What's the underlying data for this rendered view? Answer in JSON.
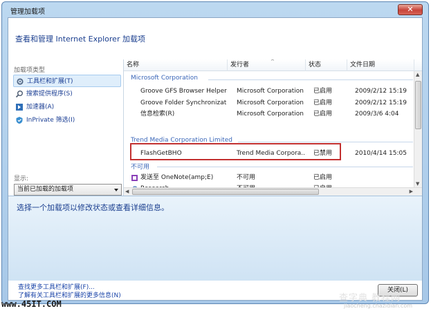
{
  "window": {
    "title": "管理加载项",
    "close_glyph": "✕"
  },
  "header": {
    "text": "查看和管理 Internet Explorer 加载项"
  },
  "sidebar": {
    "type_label": "加载项类型",
    "items": [
      {
        "label": "工具栏和扩展(T)",
        "icon": "gear-icon",
        "selected": true
      },
      {
        "label": "搜索提供程序(S)",
        "icon": "search-icon",
        "selected": false
      },
      {
        "label": "加速器(A)",
        "icon": "accelerator-icon",
        "selected": false
      },
      {
        "label": "InPrivate 筛选(I)",
        "icon": "inprivate-icon",
        "selected": false
      }
    ],
    "show_label": "显示:",
    "show_value": "当前已加载的加载项"
  },
  "list": {
    "columns": [
      "名称",
      "发行者",
      "状态",
      "文件日期"
    ],
    "groups": [
      {
        "name": "Microsoft Corporation",
        "rows": [
          {
            "name": "Groove GFS Browser Helper",
            "publisher": "Microsoft Corporation",
            "status": "已启用",
            "date": "2009/2/12 15:19"
          },
          {
            "name": "Groove Folder Synchronizati...",
            "publisher": "Microsoft Corporation",
            "status": "已启用",
            "date": "2009/2/12 15:19"
          },
          {
            "name": "信息检索(R)",
            "publisher": "Microsoft Corporation",
            "status": "已启用",
            "date": "2009/3/6 4:04"
          }
        ]
      },
      {
        "name": "Trend Media Corporation Limited",
        "rows": [
          {
            "name": "FlashGetBHO",
            "publisher": "Trend Media Corpora...",
            "status": "已禁用",
            "date": "2010/4/14 15:05"
          }
        ]
      },
      {
        "name": "不可用",
        "rows": [
          {
            "name": "发送至 OneNote(amp;E)",
            "publisher": "不可用",
            "status": "已启用",
            "date": ""
          },
          {
            "name": "Research",
            "publisher": "不可用",
            "status": "已启用",
            "date": ""
          }
        ]
      }
    ]
  },
  "details": {
    "text": "选择一个加载项以修改状态或查看详细信息。"
  },
  "footer": {
    "link1": "查找更多工具栏和扩展(F)...",
    "link2": "了解有关工具栏和扩展的更多信息(N)",
    "close_button": "关闭(L)"
  },
  "watermarks": {
    "left": "www.45IT.COM",
    "right": "查字典 教程网",
    "right_small": "jiaocheng.chazidian.com"
  },
  "colors": {
    "highlight_box": "#c23030",
    "link": "#1a44a8",
    "group": "#3a66b8"
  }
}
